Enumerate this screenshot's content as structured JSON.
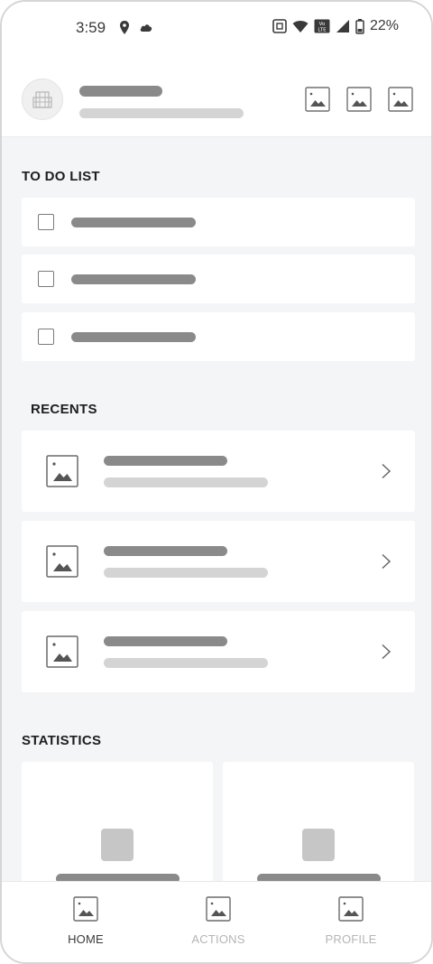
{
  "status_bar": {
    "time": "3:59",
    "battery": "22%",
    "icons": [
      "location-pin-icon",
      "cloud-icon",
      "nfc-icon",
      "wifi-icon",
      "volte-icon",
      "signal-icon",
      "battery-icon"
    ]
  },
  "header": {
    "avatar_icon": "building-icon",
    "actions": [
      "image-icon",
      "image-icon",
      "image-icon"
    ]
  },
  "sections": {
    "todo_title": "TO DO LIST",
    "recents_title": "RECENTS",
    "statistics_title": "STATISTICS"
  },
  "todo_items": [
    {
      "checked": false
    },
    {
      "checked": false
    },
    {
      "checked": false
    }
  ],
  "recents": [
    {
      "icon": "image-icon"
    },
    {
      "icon": "image-icon"
    },
    {
      "icon": "image-icon"
    }
  ],
  "nav": {
    "items": [
      {
        "label": "HOME",
        "icon": "image-icon",
        "active": true
      },
      {
        "label": "ACTIONS",
        "icon": "image-icon",
        "active": false
      },
      {
        "label": "PROFILE",
        "icon": "image-icon",
        "active": false
      }
    ]
  },
  "colors": {
    "background": "#f4f5f7",
    "card": "#ffffff",
    "placeholder_dark": "#8a8a8a",
    "placeholder_light": "#d4d4d4",
    "nav_active": "#3a3a3a",
    "nav_inactive": "#b5b5b5"
  }
}
